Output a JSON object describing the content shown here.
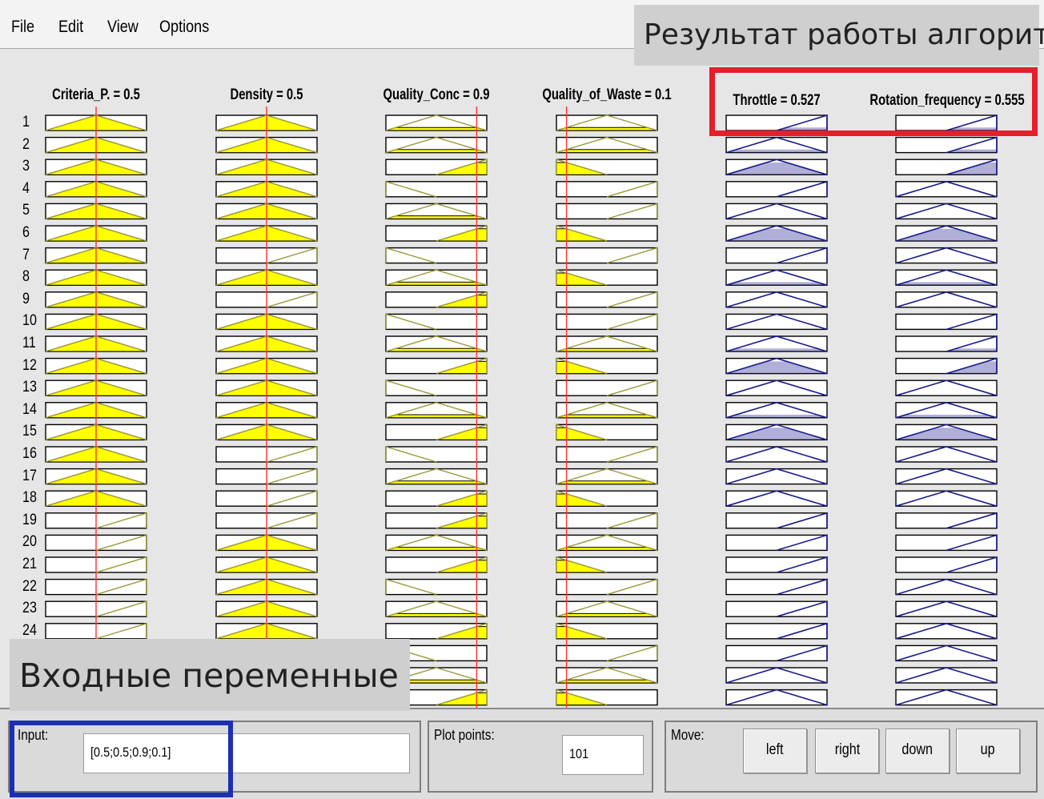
{
  "menu": {
    "file": "File",
    "edit": "Edit",
    "view": "View",
    "options": "Options"
  },
  "variables": {
    "inputs": [
      {
        "title": "Criteria_P. = 0.5"
      },
      {
        "title": "Density = 0.5"
      },
      {
        "title": "Quality_Conc = 0.9"
      },
      {
        "title": "Quality_of_Waste = 0.1"
      }
    ],
    "outputs": [
      {
        "title": "Throttle = 0.527"
      },
      {
        "title": "Rotation_frequency = 0.555"
      }
    ]
  },
  "input_values": [
    0.5,
    0.5,
    0.9,
    0.1
  ],
  "rule_numbers": [
    "1",
    "2",
    "3",
    "4",
    "5",
    "6",
    "7",
    "8",
    "9",
    "10",
    "11",
    "12",
    "13",
    "14",
    "15",
    "16",
    "17",
    "18",
    "19",
    "20",
    "21",
    "22",
    "23",
    "24"
  ],
  "rules": {
    "criteria": [
      "M",
      "M",
      "M",
      "M",
      "M",
      "M",
      "M",
      "M",
      "M",
      "M",
      "M",
      "M",
      "M",
      "M",
      "M",
      "M",
      "M",
      "M",
      "H",
      "H",
      "H",
      "H",
      "H",
      "H",
      "H",
      "H",
      "H"
    ],
    "density": [
      "M",
      "M",
      "M",
      "M",
      "M",
      "M",
      "H",
      "M",
      "H",
      "M",
      "M",
      "M",
      "M",
      "M",
      "M",
      "H",
      "H",
      "H",
      "H",
      "M",
      "M",
      "M",
      "M",
      "M",
      "M",
      "M",
      "M"
    ],
    "conc": [
      "M",
      "M",
      "H",
      "L",
      "M",
      "H",
      "L",
      "M",
      "H",
      "L",
      "M",
      "H",
      "L",
      "M",
      "H",
      "L",
      "M",
      "H",
      "H",
      "M",
      "H",
      "L",
      "M",
      "H",
      "L",
      "M",
      "H"
    ],
    "waste": [
      "M",
      "M",
      "L",
      "H",
      "H",
      "L",
      "H",
      "L",
      "H",
      "H",
      "M",
      "L",
      "H",
      "M",
      "L",
      "H",
      "M",
      "L",
      "H",
      "M",
      "L",
      "H",
      "M",
      "L",
      "H",
      "M",
      "L"
    ],
    "throttle": [
      "H",
      "M",
      "M",
      "H",
      "M",
      "M",
      "H",
      "M",
      "M",
      "M",
      "M",
      "M",
      "M",
      "M",
      "M",
      "M",
      "M",
      "M",
      "H",
      "H",
      "H",
      "H",
      "H",
      "H",
      "H",
      "M",
      "M"
    ],
    "rotation": [
      "H",
      "H",
      "H",
      "M",
      "M",
      "M",
      "M",
      "M",
      "M",
      "H",
      "H",
      "H",
      "M",
      "M",
      "M",
      "M",
      "M",
      "M",
      "H",
      "H",
      "H",
      "M",
      "M",
      "M",
      "M",
      "M",
      "M"
    ]
  },
  "colors": {
    "fill": "#ffff00",
    "input_line": "#9a9a3a",
    "output_line": "#1a1a8c",
    "marker": "#ff3030",
    "box_border": "#000000"
  },
  "annotations": {
    "output_caption": "Результат работы алгоритма",
    "input_caption": "Входные переменные"
  },
  "controls": {
    "input_label": "Input:",
    "input_value": "[0.5;0.5;0.9;0.1]",
    "plot_points_label": "Plot points:",
    "plot_points_value": "101",
    "move_label": "Move:",
    "buttons": {
      "left": "left",
      "right": "right",
      "down": "down",
      "up": "up"
    }
  }
}
